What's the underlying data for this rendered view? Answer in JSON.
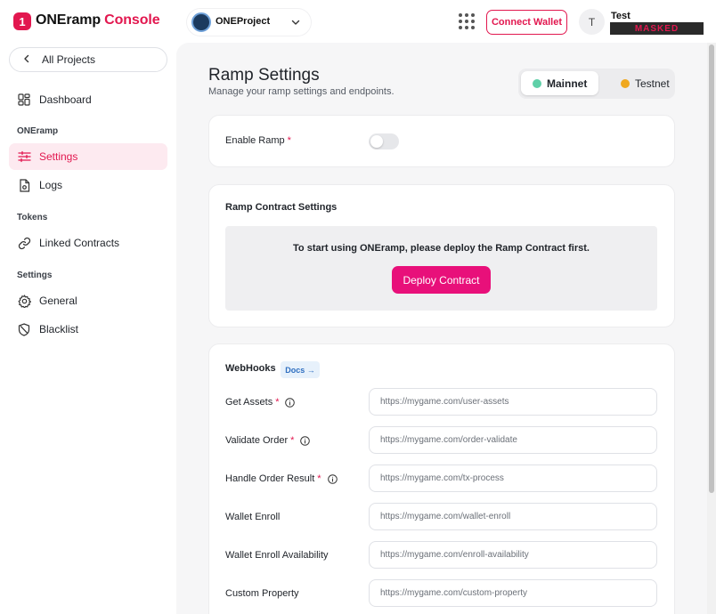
{
  "brand": {
    "badge": "1",
    "name": "ONEramp",
    "suffix": "Console",
    "color": "#e2174f"
  },
  "header": {
    "project_name": "ONEProject",
    "connect_wallet_label": "Connect Wallet",
    "user_initial": "T",
    "user_name": "Test",
    "user_masked": "MASKED"
  },
  "sidebar": {
    "back_label": "All Projects",
    "dashboard": "Dashboard",
    "section_oneramp": "ONEramp",
    "settings": "Settings",
    "logs": "Logs",
    "section_tokens": "Tokens",
    "linked_contracts": "Linked Contracts",
    "section_settings": "Settings",
    "general": "General",
    "blacklist": "Blacklist",
    "active_item": "Settings"
  },
  "page": {
    "title": "Ramp Settings",
    "subtitle": "Manage your ramp settings and endpoints."
  },
  "network": {
    "mainnet": "Mainnet",
    "testnet": "Testnet",
    "selected": "Mainnet",
    "mainnet_color": "#5fd0a8",
    "testnet_color": "#f0a81e"
  },
  "enable_ramp": {
    "label": "Enable Ramp",
    "required": "*",
    "enabled": false
  },
  "contract": {
    "title": "Ramp Contract Settings",
    "message": "To start using ONEramp, please deploy the Ramp Contract first.",
    "deploy_label": "Deploy Contract"
  },
  "webhooks": {
    "title": "WebHooks",
    "docs_label": "Docs →",
    "fields": [
      {
        "label": "Get Assets",
        "required": "*",
        "info": true,
        "placeholder": "https://mygame.com/user-assets"
      },
      {
        "label": "Validate Order",
        "required": "*",
        "info": true,
        "placeholder": "https://mygame.com/order-validate"
      },
      {
        "label": "Handle Order Result",
        "required": "*",
        "info": true,
        "placeholder": "https://mygame.com/tx-process"
      },
      {
        "label": "Wallet Enroll",
        "required": "",
        "info": false,
        "placeholder": "https://mygame.com/wallet-enroll"
      },
      {
        "label": "Wallet Enroll Availability",
        "required": "",
        "info": false,
        "placeholder": "https://mygame.com/enroll-availability"
      },
      {
        "label": "Custom Property",
        "required": "",
        "info": false,
        "placeholder": "https://mygame.com/custom-property"
      }
    ]
  }
}
